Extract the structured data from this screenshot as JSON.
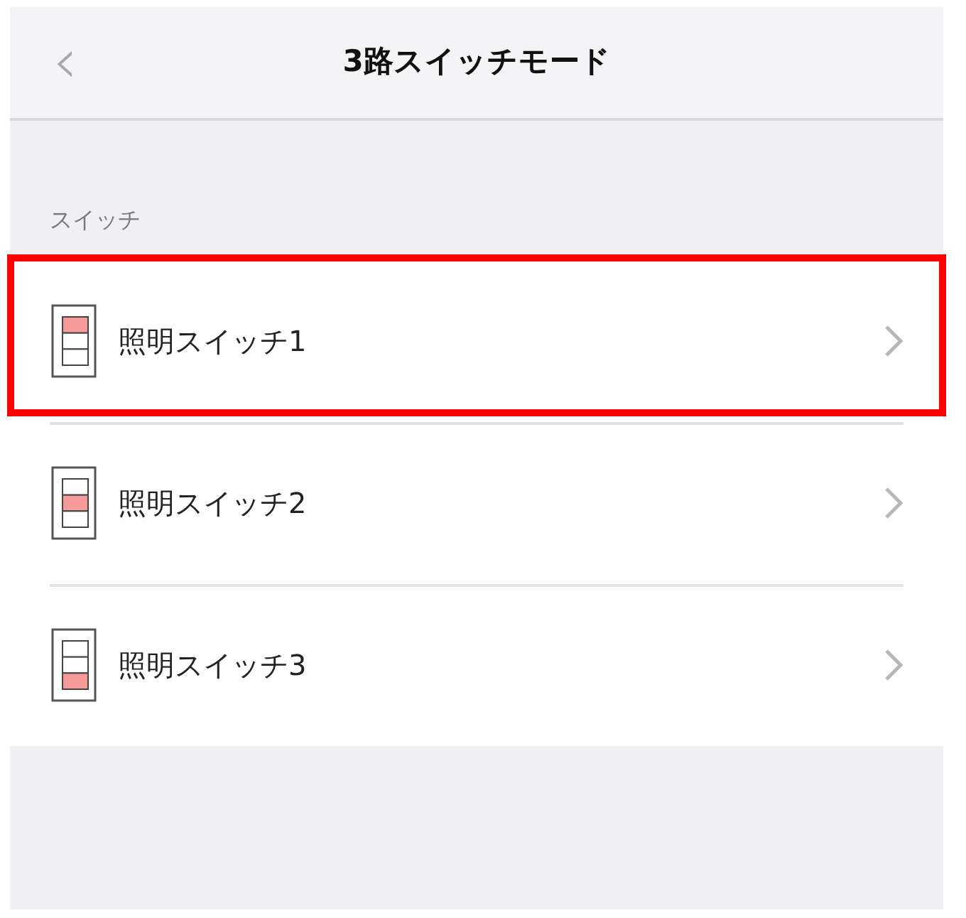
{
  "nav": {
    "back": "‹",
    "title": "3路スイッチモード"
  },
  "section_label": "スイッチ",
  "switches": [
    {
      "label": "照明スイッチ1",
      "highlighted": true,
      "segments": [
        {
          "on": true
        },
        {
          "on": false
        },
        {
          "on": false
        }
      ]
    },
    {
      "label": "照明スイッチ2",
      "highlighted": false,
      "segments": [
        {
          "on": false
        },
        {
          "on": true
        },
        {
          "on": false
        }
      ]
    },
    {
      "label": "照明スイッチ3",
      "highlighted": false,
      "segments": [
        {
          "on": false
        },
        {
          "on": false
        },
        {
          "on": true
        }
      ]
    }
  ]
}
